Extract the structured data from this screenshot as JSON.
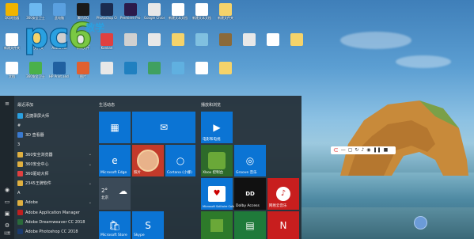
{
  "desktop": {
    "row1": [
      {
        "label": "QQ浏览器",
        "color": "#f0b400"
      },
      {
        "label": "360安全卫士",
        "color": "#6cb8f0"
      },
      {
        "label": "此电脑",
        "color": "#5aa0e0"
      },
      {
        "label": "腾讯QQ",
        "color": "#1a1a1a"
      },
      {
        "label": "Photoshop CC",
        "color": "#1b2b4f"
      },
      {
        "label": "Premiere Pro CC",
        "color": "#2b1a4a"
      },
      {
        "label": "Google Chrome",
        "color": "#e8e8e8"
      },
      {
        "label": "新建文本文档",
        "color": "#ffffff"
      },
      {
        "label": "新建文本文档",
        "color": "#ffffff"
      },
      {
        "label": "新建文件夹",
        "color": "#f5d36a"
      }
    ],
    "row2": [
      {
        "label": "",
        "color": "#e0a020"
      },
      {
        "label": "",
        "color": "#c07030"
      },
      {
        "label": "",
        "color": "#4a90d0"
      },
      {
        "label": "",
        "color": "#80c0e0"
      },
      {
        "label": "",
        "color": "#8a6a3a"
      },
      {
        "label": "",
        "color": "#e8e8e8"
      },
      {
        "label": "",
        "color": "#ffffff"
      },
      {
        "label": "",
        "color": "#f5d36a"
      }
    ],
    "row3": [
      {
        "label": "新建文件夹",
        "color": "#ffffff"
      },
      {
        "label": "新建文件夹",
        "color": "#f5d36a"
      },
      {
        "label": "AutoDesk",
        "color": "#cfcfcf"
      },
      {
        "label": "新建文件",
        "color": "#e8e8e8"
      },
      {
        "label": "Kankan",
        "color": "#e04040"
      },
      {
        "label": "",
        "color": "#d0d0d0"
      },
      {
        "label": "",
        "color": "#e8e8e8"
      },
      {
        "label": "",
        "color": "#f5d36a"
      }
    ],
    "row4": [
      {
        "label": "文档",
        "color": "#ffffff"
      },
      {
        "label": "360安全卫士",
        "color": "#4ab04a"
      },
      {
        "label": "HP Print and Scan Doctor",
        "color": "#2060a0"
      },
      {
        "label": "图片",
        "color": "#e06030"
      },
      {
        "label": "",
        "color": "#e8e8e8"
      },
      {
        "label": "",
        "color": "#2080c0"
      },
      {
        "label": "",
        "color": "#40a060"
      },
      {
        "label": "",
        "color": "#60b0e0"
      },
      {
        "label": "",
        "color": "#ffffff"
      },
      {
        "label": "",
        "color": "#f5d36a"
      }
    ]
  },
  "logo": {
    "text": "pc6",
    "sub": "教学"
  },
  "startmenu": {
    "recent_title": "最近添加",
    "apps": [
      {
        "label": "迅捷录屏大师",
        "color": "#2aa0e0"
      },
      {
        "label": "#",
        "color": ""
      },
      {
        "label": "3D 查看器",
        "color": "#3a7ad0"
      },
      {
        "label": "3",
        "color": ""
      },
      {
        "label": "360安全浏览器",
        "color": "#e0b040"
      },
      {
        "label": "360安全中心",
        "color": "#e0b040"
      },
      {
        "label": "360驱动大师",
        "color": "#e04040"
      },
      {
        "label": "2345王牌软件",
        "color": "#e0b040"
      },
      {
        "label": "A",
        "color": ""
      },
      {
        "label": "Adobe",
        "color": "#e0b040"
      },
      {
        "label": "Adobe Application Manager",
        "color": "#c02020"
      },
      {
        "label": "Adobe Dreamweaver CC 2018",
        "color": "#2a6a3a"
      },
      {
        "label": "Adobe Photoshop CC 2018",
        "color": "#1b3b6f"
      }
    ],
    "life_title": "生活动态",
    "play_title": "播放和浏览",
    "tiles": {
      "calendar": "",
      "mail": "",
      "edge": "Microsoft Edge",
      "photos": "照片",
      "cortana": "Cortana (小娜)",
      "weather_temp": "2°",
      "weather_sub": "北京",
      "store": "Microsoft Store",
      "skype": "Skype",
      "movies": "电影和电视",
      "xbox": "Xbox 控制台",
      "groove": "Groove 音乐",
      "solitaire": "Microsoft Solitaire Collection",
      "dolby": "Dolby Access",
      "netease": "网易云音乐",
      "minecraft": "",
      "office": "",
      "onenote": ""
    },
    "rail": {
      "settings": "设置"
    }
  },
  "toolbar_icons": [
    "record-icon",
    "minimize-icon",
    "fullscreen-icon",
    "refresh-icon",
    "mic-icon",
    "camera-icon",
    "pause-icon",
    "stop-icon"
  ]
}
